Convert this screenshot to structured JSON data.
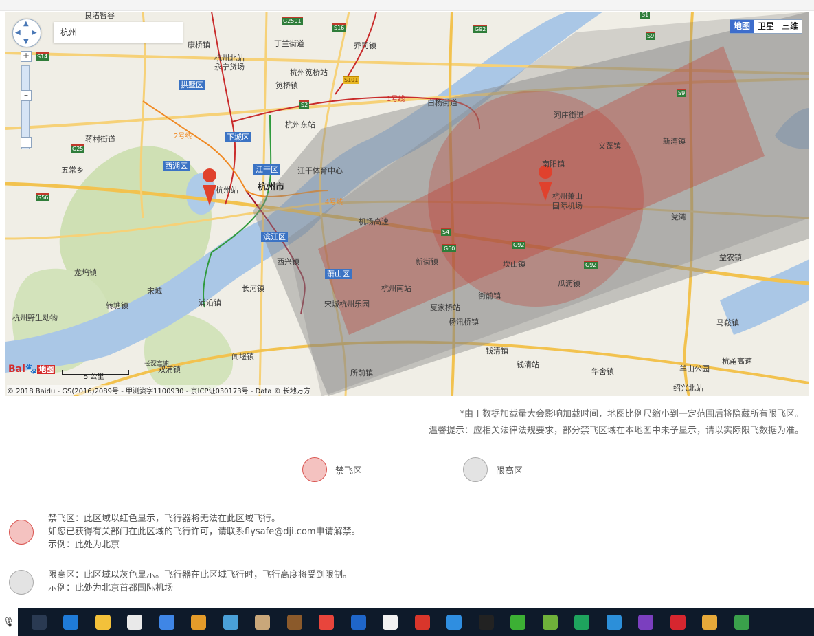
{
  "search": {
    "value": "杭州"
  },
  "map_types": [
    "地图",
    "卫星",
    "三维"
  ],
  "map_labels": {
    "districts": [
      "拱墅区",
      "下城区",
      "西湖区",
      "江干区",
      "滨江区",
      "萧山区"
    ],
    "city": "杭州市",
    "places": [
      "良渚智谷",
      "康桥镇",
      "杭州北站",
      "永宁货场",
      "丁兰街道",
      "乔司镇",
      "杭州笕桥站",
      "笕桥镇",
      "白杨街道",
      "河庄街道",
      "杭州东站",
      "蒋村街道",
      "五常乡",
      "江干体育中心",
      "杭州站",
      "义蓬镇",
      "新湾镇",
      "南阳镇",
      "杭州萧山",
      "国际机场",
      "机场高速",
      "杭甬高速",
      "党湾",
      "新街镇",
      "西兴镇",
      "坎山镇",
      "瓜沥镇",
      "益农镇",
      "龙坞镇",
      "宋城",
      "长河镇",
      "杭州南站",
      "转塘镇",
      "浦沿镇",
      "宋城杭州乐园",
      "夏家桥站",
      "街前镇",
      "杭州野生动物",
      "杨汛桥镇",
      "马鞍镇",
      "钱清镇",
      "钱清站",
      "羊山公园",
      "双浦镇",
      "闻堰镇",
      "所前镇",
      "华舍镇",
      "绍兴北站",
      "长深高速",
      "1号线",
      "2号线",
      "4号线"
    ],
    "shields": [
      "G2501",
      "S16",
      "G92",
      "S14",
      "S1",
      "S2",
      "S101",
      "G25",
      "G56",
      "S9",
      "S4",
      "G60",
      "G92",
      "G92",
      "S9"
    ]
  },
  "scale_label": "5 公里",
  "baidu_logo": "Bai",
  "baidu_logo_tag": "地图",
  "copyright": "© 2018 Baidu - GS(2016)2089号 - 甲测资字1100930 - 京ICP证030173号 - Data © 长地万方",
  "notes": [
    "*由于数据加载量大会影响加载时间，地图比例尺缩小到一定范围后将隐藏所有限飞区。",
    "温馨提示：应相关法律法规要求，部分禁飞区域在本地图中未予显示，请以实际限飞数据为准。"
  ],
  "legend": [
    {
      "label": "禁飞区",
      "color": "#f4c2c0"
    },
    {
      "label": "限高区",
      "color": "#e3e3e3"
    }
  ],
  "descriptions": [
    {
      "lines": [
        "禁飞区：此区域以红色显示，飞行器将无法在此区域飞行。",
        "如您已获得有关部门在此区域的飞行许可，请联系flysafe@dji.com申请解禁。",
        "示例：此处为北京"
      ]
    },
    {
      "lines": [
        "限高区：此区域以灰色显示。飞行器在此区域飞行时，飞行高度将受到限制。",
        "示例：此处为北京首都国际机场"
      ]
    }
  ],
  "taskbar": [
    {
      "name": "task-view-icon",
      "color": "#2a3a52"
    },
    {
      "name": "edge-icon",
      "color": "#1f7bd8"
    },
    {
      "name": "file-explorer-icon",
      "color": "#f3c13a"
    },
    {
      "name": "store-icon",
      "color": "#e9e9e9"
    },
    {
      "name": "feishu-icon",
      "color": "#3f86e6"
    },
    {
      "name": "package-icon",
      "color": "#e49b2a"
    },
    {
      "name": "monitor-icon",
      "color": "#4aa0d8"
    },
    {
      "name": "tools-icon",
      "color": "#c9a77a"
    },
    {
      "name": "book-icon",
      "color": "#8b5a2b"
    },
    {
      "name": "chrome-icon",
      "color": "#e8453c"
    },
    {
      "name": "maxthon-icon",
      "color": "#1f66c9"
    },
    {
      "name": "mail-icon",
      "color": "#f2f2f2"
    },
    {
      "name": "sync-icon",
      "color": "#d9362b"
    },
    {
      "name": "wps-writer-icon",
      "color": "#2f8ee0"
    },
    {
      "name": "unity-icon",
      "color": "#222222"
    },
    {
      "name": "wechat-icon",
      "color": "#3cb034"
    },
    {
      "name": "notepad-icon",
      "color": "#6fb13a"
    },
    {
      "name": "wps-sheet-icon",
      "color": "#1ea35d"
    },
    {
      "name": "feather-icon",
      "color": "#2c8fd9"
    },
    {
      "name": "visual-studio-icon",
      "color": "#7b3fbf"
    },
    {
      "name": "stamp-icon",
      "color": "#d6262f"
    },
    {
      "name": "paint-icon",
      "color": "#e6a93a"
    },
    {
      "name": "evernote-icon",
      "color": "#3aa04b"
    }
  ]
}
